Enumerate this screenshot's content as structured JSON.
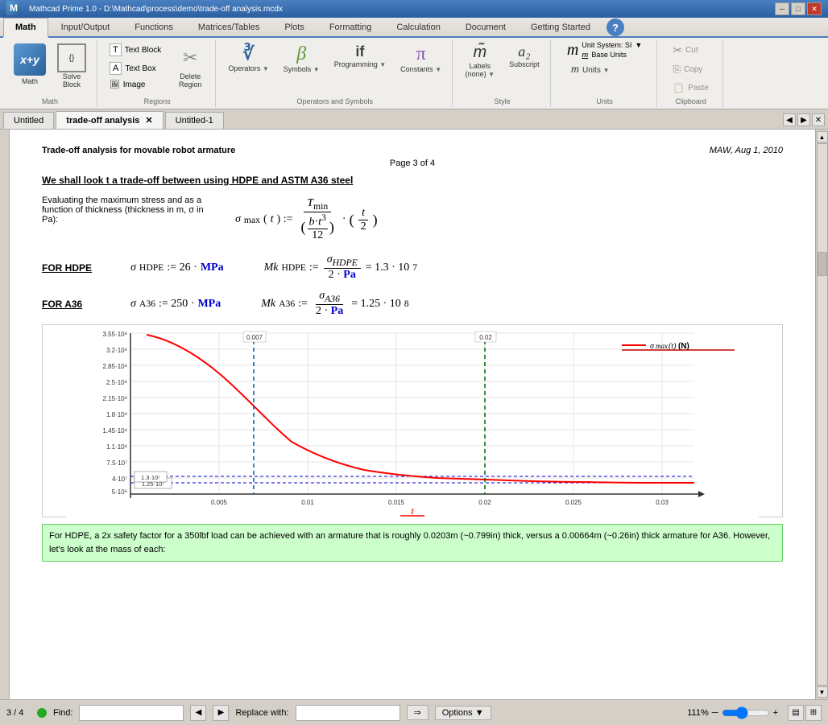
{
  "titlebar": {
    "title": "Mathcad Prime 1.0 - D:\\Mathcad\\process\\demo\\trade-off analysis.mcdx",
    "app_icon": "M"
  },
  "ribbon": {
    "tabs": [
      {
        "label": "Math",
        "active": true
      },
      {
        "label": "Input/Output",
        "active": false
      },
      {
        "label": "Functions",
        "active": false
      },
      {
        "label": "Matrices/Tables",
        "active": false
      },
      {
        "label": "Plots",
        "active": false
      },
      {
        "label": "Formatting",
        "active": false
      },
      {
        "label": "Calculation",
        "active": false
      },
      {
        "label": "Document",
        "active": false
      },
      {
        "label": "Getting Started",
        "active": false
      }
    ],
    "groups": {
      "math": {
        "label": "Math",
        "solve_label": "Solve\nBlock"
      },
      "regions": {
        "label": "Regions",
        "text_block": "Text Block",
        "text_box": "Text Box",
        "image": "Image",
        "delete_region": "Delete\nRegion"
      },
      "operators_symbols": {
        "label": "Operators and Symbols",
        "operators": "Operators",
        "symbols": "Symbols",
        "programming": "Programming",
        "constants": "Constants"
      },
      "style": {
        "label": "Style",
        "labels": "Labels\n(none)",
        "subscript": "Subscript"
      },
      "units": {
        "label": "Units",
        "units": "Units",
        "unit_system": "Unit System: SI",
        "base_units": "Base Units"
      },
      "clipboard": {
        "label": "Clipboard",
        "cut": "Cut",
        "copy": "Copy",
        "paste": "Paste"
      }
    }
  },
  "doc_tabs": [
    {
      "label": "Untitled",
      "active": false
    },
    {
      "label": "trade-off analysis",
      "active": true
    },
    {
      "label": "Untitled-1",
      "active": false
    }
  ],
  "document": {
    "title": "Trade-off analysis for movable robot armature",
    "date": "MAW, Aug 1, 2010",
    "page": "Page 3 of 4",
    "heading": "We shall look t a trade-off between using HDPE and ASTM A36 steel",
    "intro_text": "Evaluating the maximum stress and as a function of thickness (thickness in m, σ in Pa):",
    "hdpe_label": "FOR HDPE",
    "a36_label": "FOR A36",
    "hdpe_sigma": "σ_HDPE := 26 · MPa",
    "hdpe_mk": "Mk_HDPE := σ_HDPE / (2·Pa) = 1.3·10⁷",
    "a36_sigma": "σ_A36 := 250 · MPa",
    "a36_mk": "Mk_A36 := σ_A36 / (2·Pa) = 1.25·10⁸",
    "chart": {
      "x_label": "t",
      "y_values": [
        "3.55·10⁸",
        "3.2·10⁸",
        "2.85·10⁸",
        "2.5·10⁸",
        "2.15·10⁸",
        "1.8·10⁸",
        "1.45·10⁸",
        "1.1·10⁸",
        "7.5·10⁷",
        "4·10⁷",
        "5·10⁶"
      ],
      "x_values": [
        "0.005",
        "0.01",
        "0.015",
        "0.02",
        "0.025",
        "0.03"
      ],
      "marker_left": "0.007",
      "marker_right": "0.02",
      "label_left": "1.25·10⁷",
      "label_right": "1.3·10⁷",
      "legend": "σ_max(t)  (N)"
    },
    "footnote": "For HDPE, a 2x safety factor for a 350lbf load can be achieved with an armature that is roughly 0.0203m (~0.799in) thick, versus a 0.00664m (~0.26in) thick armature for A36.  However, let's look at the mass of each:"
  },
  "statusbar": {
    "page": "3 / 4",
    "find_label": "Find:",
    "find_placeholder": "",
    "replace_label": "Replace with:",
    "replace_placeholder": "",
    "replace_btn": "→",
    "options_label": "Options",
    "zoom": "111%"
  }
}
